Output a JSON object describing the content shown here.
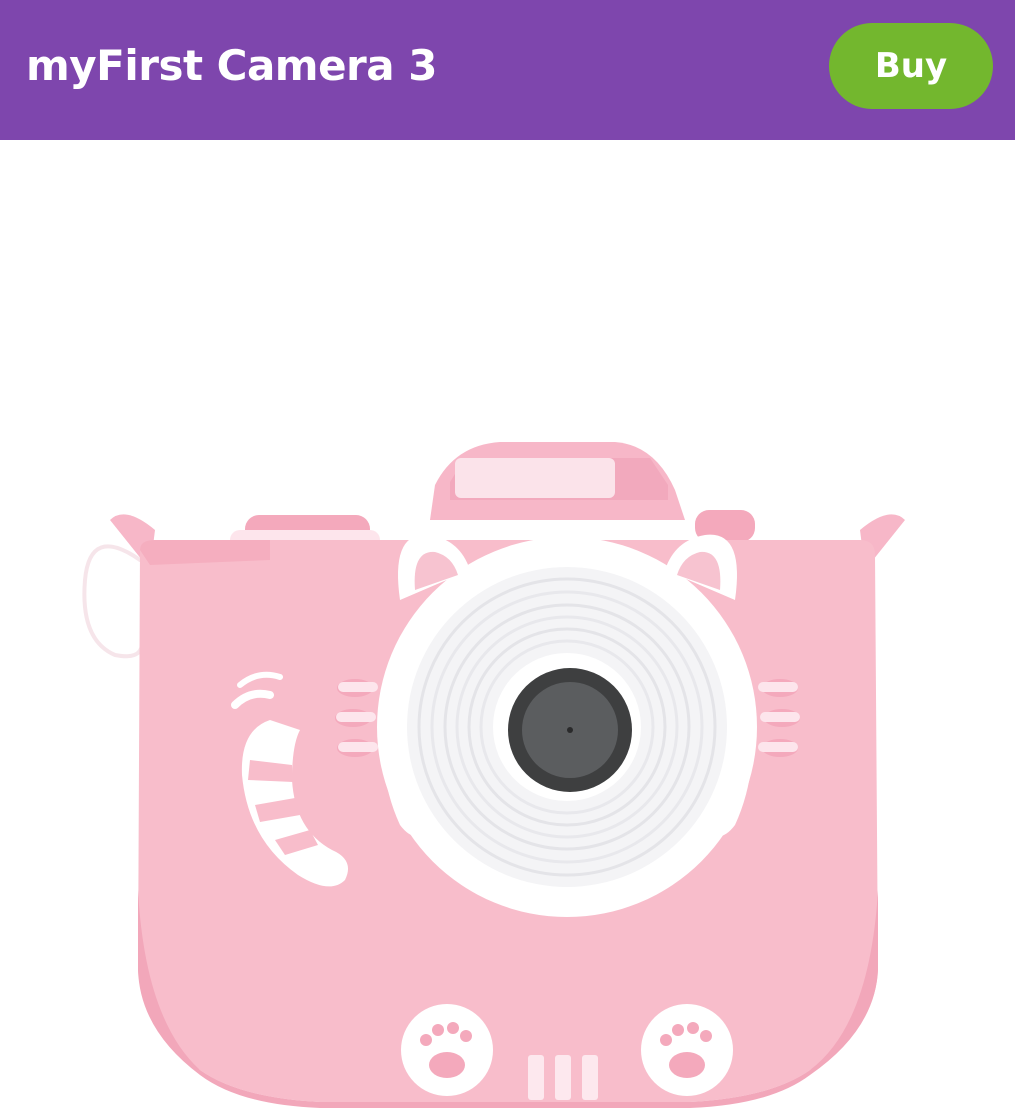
{
  "header": {
    "title": "myFirst Camera 3",
    "buy_label": "Buy",
    "background_color": "#7e46ad",
    "buy_color": "#73b72e"
  },
  "product": {
    "image_icon": "camera-icon"
  }
}
